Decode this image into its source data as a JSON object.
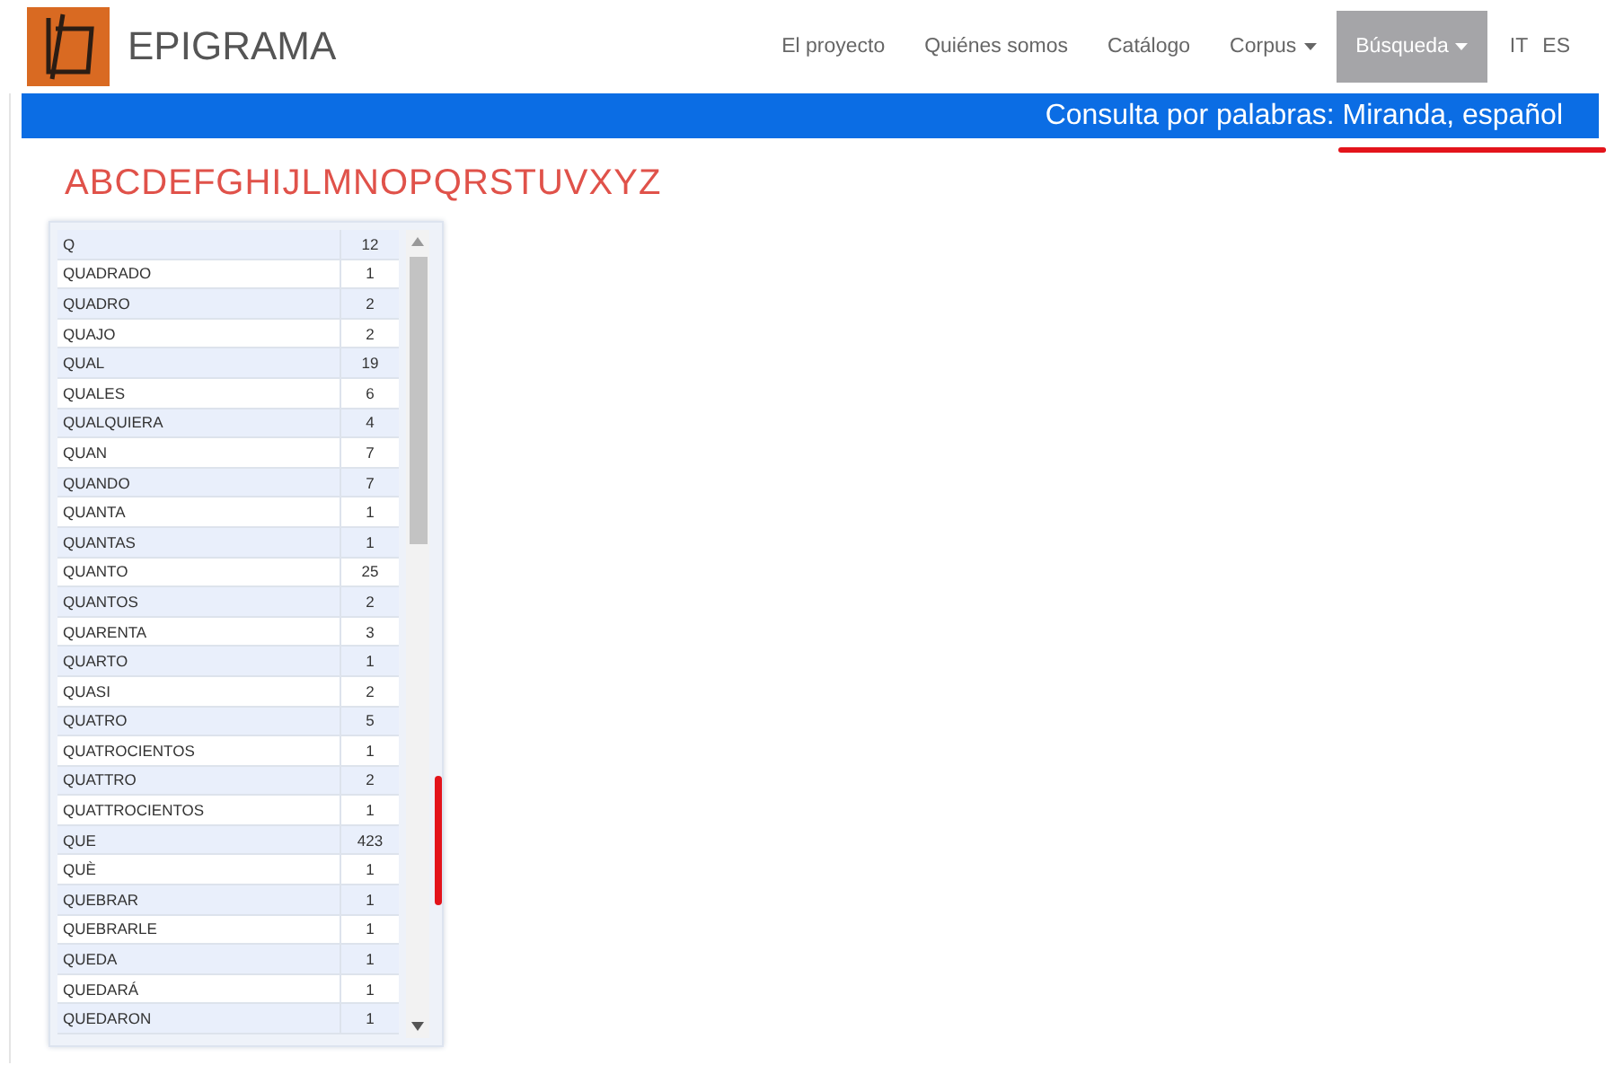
{
  "brand": {
    "title": "EPIGRAMA"
  },
  "nav": [
    {
      "label": "El proyecto",
      "dropdown": false,
      "selected": false
    },
    {
      "label": "Quiénes somos",
      "dropdown": false,
      "selected": false
    },
    {
      "label": "Catálogo",
      "dropdown": false,
      "selected": false
    },
    {
      "label": "Corpus",
      "dropdown": true,
      "selected": false
    },
    {
      "label": "Búsqueda",
      "dropdown": true,
      "selected": true
    }
  ],
  "languages": [
    "IT",
    "ES"
  ],
  "banner": {
    "title": "Consulta por palabras: Miranda, español"
  },
  "alphabet": [
    "A",
    "B",
    "C",
    "D",
    "E",
    "F",
    "G",
    "H",
    "I",
    "J",
    "L",
    "M",
    "N",
    "O",
    "P",
    "Q",
    "R",
    "S",
    "T",
    "U",
    "V",
    "X",
    "Y",
    "Z"
  ],
  "table": {
    "rows": [
      {
        "word": "Q",
        "count": "12"
      },
      {
        "word": "QUADRADO",
        "count": "1"
      },
      {
        "word": "QUADRO",
        "count": "2"
      },
      {
        "word": "QUAJO",
        "count": "2"
      },
      {
        "word": "QUAL",
        "count": "19"
      },
      {
        "word": "QUALES",
        "count": "6"
      },
      {
        "word": "QUALQUIERA",
        "count": "4"
      },
      {
        "word": "QUAN",
        "count": "7"
      },
      {
        "word": "QUANDO",
        "count": "7"
      },
      {
        "word": "QUANTA",
        "count": "1"
      },
      {
        "word": "QUANTAS",
        "count": "1"
      },
      {
        "word": "QUANTO",
        "count": "25"
      },
      {
        "word": "QUANTOS",
        "count": "2"
      },
      {
        "word": "QUARENTA",
        "count": "3"
      },
      {
        "word": "QUARTO",
        "count": "1"
      },
      {
        "word": "QUASI",
        "count": "2"
      },
      {
        "word": "QUATRO",
        "count": "5"
      },
      {
        "word": "QUATROCIENTOS",
        "count": "1"
      },
      {
        "word": "QUATTRO",
        "count": "2"
      },
      {
        "word": "QUATTROCIENTOS",
        "count": "1"
      },
      {
        "word": "QUE",
        "count": "423"
      },
      {
        "word": "QUÈ",
        "count": "1"
      },
      {
        "word": "QUEBRAR",
        "count": "1"
      },
      {
        "word": "QUEBRARLE",
        "count": "1"
      },
      {
        "word": "QUEDA",
        "count": "1"
      },
      {
        "word": "QUEDARÁ",
        "count": "1"
      },
      {
        "word": "QUEDARON",
        "count": "1"
      }
    ]
  }
}
